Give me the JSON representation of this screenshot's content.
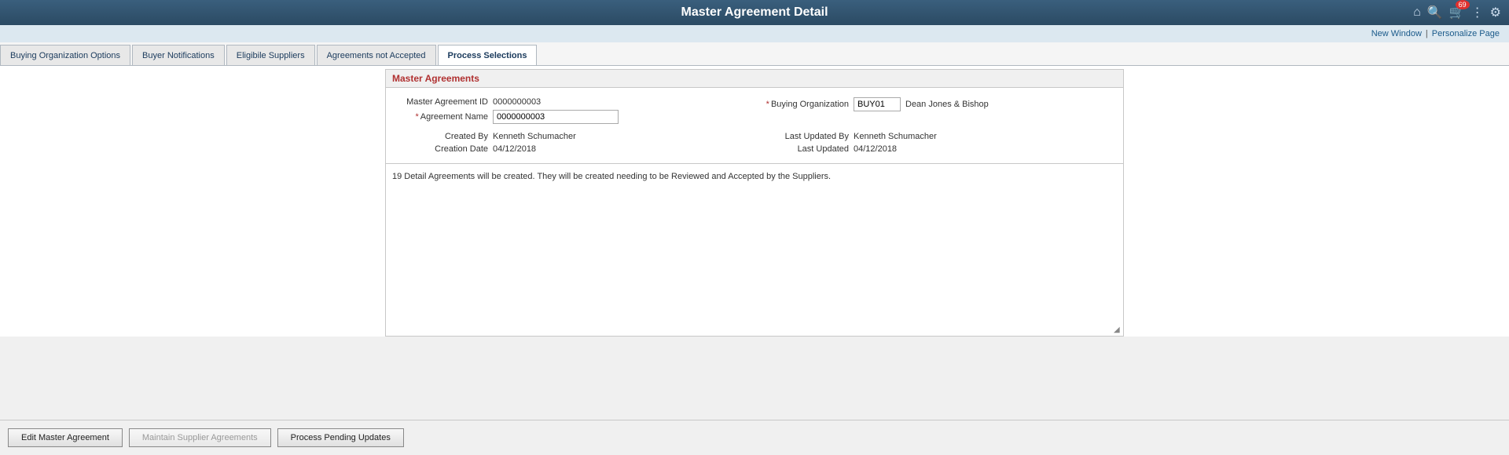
{
  "header": {
    "title": "Master Agreement Detail",
    "icons": {
      "home": "⌂",
      "search": "🔍",
      "cart": "🛒",
      "cart_badge": "69",
      "more": "⋮",
      "settings": "⚙"
    }
  },
  "top_links": {
    "new_window": "New Window",
    "personalize_page": "Personalize Page",
    "separator": "|"
  },
  "tabs": [
    {
      "id": "buying-org",
      "label": "Buying Organization Options",
      "active": false
    },
    {
      "id": "buyer-notifications",
      "label": "Buyer Notifications",
      "active": false
    },
    {
      "id": "eligible-suppliers",
      "label": "Eligibile Suppliers",
      "active": false
    },
    {
      "id": "agreements-not-accepted",
      "label": "Agreements not Accepted",
      "active": false
    },
    {
      "id": "process-selections",
      "label": "Process Selections",
      "active": true
    }
  ],
  "master_agreements": {
    "section_title": "Master Agreements",
    "fields": {
      "master_agreement_id_label": "Master Agreement ID",
      "master_agreement_id_value": "0000000003",
      "agreement_name_label": "*Agreement Name",
      "agreement_name_value": "0000000003",
      "buying_org_label": "*Buying Organization",
      "buying_org_value": "BUY01",
      "buying_org_name": "Dean Jones & Bishop",
      "created_by_label": "Created By",
      "created_by_value": "Kenneth Schumacher",
      "last_updated_by_label": "Last Updated By",
      "last_updated_by_value": "Kenneth Schumacher",
      "creation_date_label": "Creation Date",
      "creation_date_value": "04/12/2018",
      "last_updated_label": "Last Updated",
      "last_updated_value": "04/12/2018"
    }
  },
  "message": {
    "text": "19 Detail Agreements will be created. They will be created needing to be Reviewed and Accepted by the Suppliers."
  },
  "footer": {
    "edit_button": "Edit Master Agreement",
    "maintain_button": "Maintain Supplier Agreements",
    "process_button": "Process Pending Updates"
  }
}
